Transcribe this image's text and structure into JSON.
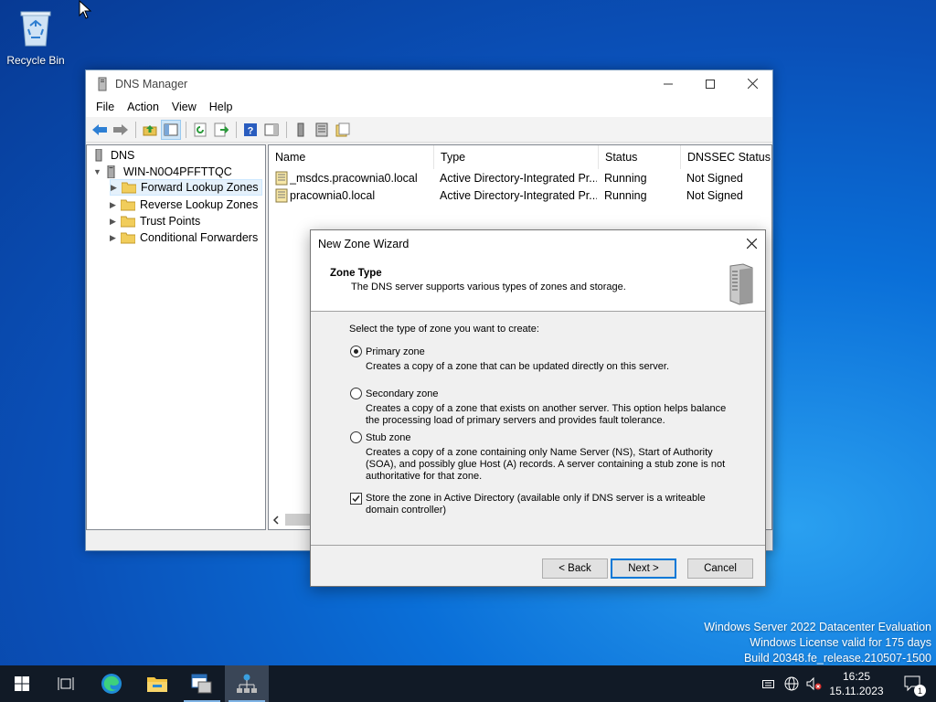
{
  "desktop": {
    "recycle_bin_label": "Recycle Bin",
    "watermark": [
      "Windows Server 2022 Datacenter Evaluation",
      "Windows License valid for 175 days",
      "Build 20348.fe_release.210507-1500"
    ]
  },
  "window": {
    "title": "DNS Manager",
    "menu": [
      "File",
      "Action",
      "View",
      "Help"
    ],
    "tree": {
      "root": "DNS",
      "server": "WIN-N0O4PFFTTQC",
      "children": [
        "Forward Lookup Zones",
        "Reverse Lookup Zones",
        "Trust Points",
        "Conditional Forwarders"
      ],
      "selected_index": 0
    },
    "list": {
      "columns": [
        "Name",
        "Type",
        "Status",
        "DNSSEC Status"
      ],
      "rows": [
        {
          "name": "_msdcs.pracownia0.local",
          "type": "Active Directory-Integrated Pr...",
          "status": "Running",
          "dnssec": "Not Signed"
        },
        {
          "name": "pracownia0.local",
          "type": "Active Directory-Integrated Pr...",
          "status": "Running",
          "dnssec": "Not Signed"
        }
      ]
    }
  },
  "dialog": {
    "title": "New Zone Wizard",
    "heading": "Zone Type",
    "subheading": "The DNS server supports various types of zones and storage.",
    "prompt": "Select the type of zone you want to create:",
    "options": [
      {
        "label": "Primary zone",
        "desc": "Creates a copy of a zone that can be updated directly on this server.",
        "selected": true
      },
      {
        "label": "Secondary zone",
        "desc": "Creates a copy of a zone that exists on another server. This option helps balance the processing load of primary servers and provides fault tolerance.",
        "selected": false
      },
      {
        "label": "Stub zone",
        "desc": "Creates a copy of a zone containing only Name Server (NS), Start of Authority (SOA), and possibly glue Host (A) records. A server containing a stub zone is not authoritative for that zone.",
        "selected": false
      }
    ],
    "store_ad_label": "Store the zone in Active Directory (available only if DNS server is a writeable domain controller)",
    "store_ad_checked": true,
    "buttons": {
      "back": "< Back",
      "next": "Next >",
      "cancel": "Cancel"
    }
  },
  "taskbar": {
    "time": "16:25",
    "date": "15.11.2023",
    "notification_count": "1"
  }
}
